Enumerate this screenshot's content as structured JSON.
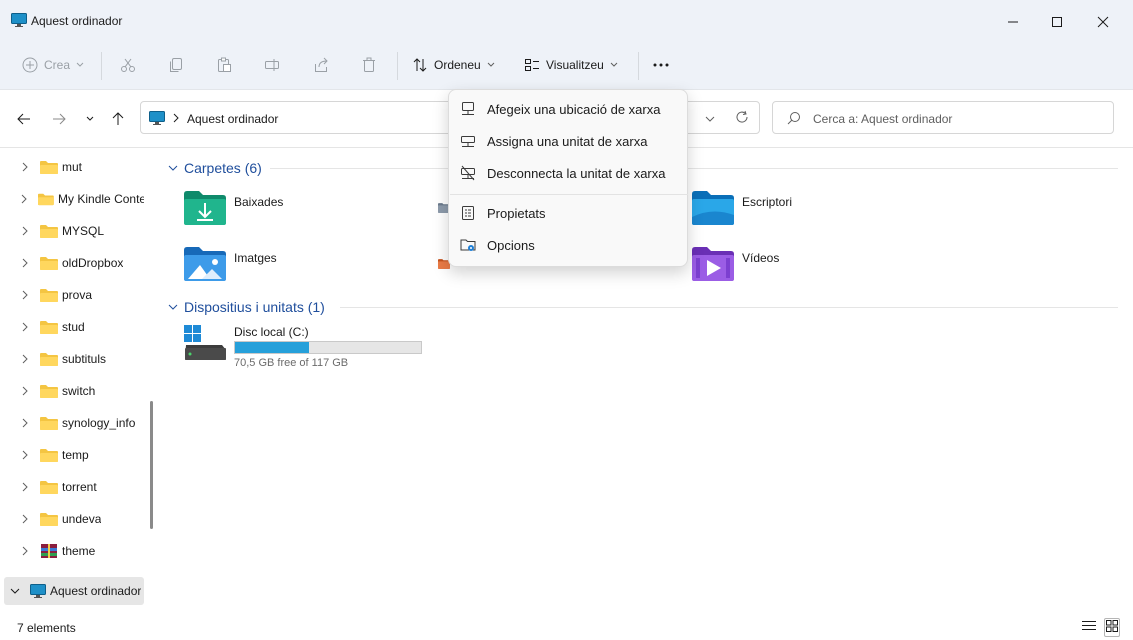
{
  "window": {
    "title": "Aquest ordinador"
  },
  "toolbar": {
    "new_label": "Crea",
    "sort_label": "Ordeneu",
    "view_label": "Visualitzeu",
    "more_label": "..."
  },
  "address": {
    "path": "Aquest ordinador",
    "search_placeholder": "Cerca a: Aquest ordinador"
  },
  "sidebar": {
    "items": [
      {
        "label": "mut",
        "icon": "folder-icon"
      },
      {
        "label": "My Kindle Content",
        "icon": "folder-icon"
      },
      {
        "label": "MYSQL",
        "icon": "folder-icon"
      },
      {
        "label": "oldDropbox",
        "icon": "folder-icon"
      },
      {
        "label": "prova",
        "icon": "folder-icon"
      },
      {
        "label": "stud",
        "icon": "folder-icon"
      },
      {
        "label": "subtituls",
        "icon": "folder-icon"
      },
      {
        "label": "switch",
        "icon": "folder-icon"
      },
      {
        "label": "synology_info",
        "icon": "folder-icon"
      },
      {
        "label": "temp",
        "icon": "folder-icon"
      },
      {
        "label": "torrent",
        "icon": "folder-icon"
      },
      {
        "label": "undeva",
        "icon": "folder-icon"
      },
      {
        "label": "theme",
        "icon": "archive-icon"
      }
    ],
    "selected": {
      "label": "Aquest ordinador",
      "icon": "computer-icon"
    }
  },
  "groups": {
    "folders_header": "Carpetes (6)",
    "folders": [
      {
        "label": "Baixades",
        "icon": "downloads-folder-icon"
      },
      {
        "label": "Escriptori",
        "icon": "desktop-folder-icon"
      },
      {
        "label": "Imatges",
        "icon": "pictures-folder-icon"
      },
      {
        "label": "Vídeos",
        "icon": "videos-folder-icon"
      }
    ],
    "devices_header": "Dispositius i unitats (1)",
    "drive": {
      "label": "Disc local (C:)",
      "free_text": "70,5 GB free of 117 GB",
      "used_fraction": 0.397
    }
  },
  "menu": {
    "items": [
      {
        "label": "Afegeix una ubicació de xarxa",
        "icon": "network-location-icon"
      },
      {
        "label": "Assigna una unitat de xarxa",
        "icon": "map-network-drive-icon"
      },
      {
        "label": "Desconnecta la unitat de xarxa",
        "icon": "disconnect-network-drive-icon"
      },
      {
        "label": "Propietats",
        "icon": "properties-icon"
      },
      {
        "label": "Opcions",
        "icon": "options-icon"
      }
    ]
  },
  "status": {
    "count": "7 elements"
  },
  "colors": {
    "accent": "#1f4e9c",
    "drive_fill": "#26a0da",
    "folder": "#f4c542"
  }
}
